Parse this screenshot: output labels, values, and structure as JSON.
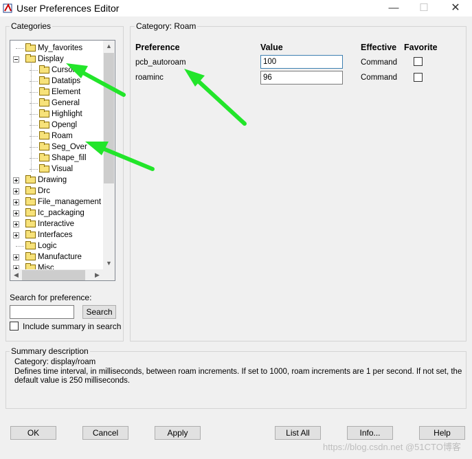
{
  "window": {
    "title": "User Preferences Editor",
    "minimize_glyph": "—",
    "maximize_glyph": "☐",
    "close_glyph": "✕"
  },
  "categories": {
    "label": "Categories",
    "nodes": [
      {
        "label": "My_favorites",
        "level": 0,
        "expander": "none"
      },
      {
        "label": "Display",
        "level": 0,
        "expander": "collapse"
      },
      {
        "label": "Cursor",
        "level": 1,
        "expander": "none"
      },
      {
        "label": "Datatips",
        "level": 1,
        "expander": "none"
      },
      {
        "label": "Element",
        "level": 1,
        "expander": "none"
      },
      {
        "label": "General",
        "level": 1,
        "expander": "none"
      },
      {
        "label": "Highlight",
        "level": 1,
        "expander": "none"
      },
      {
        "label": "Opengl",
        "level": 1,
        "expander": "none"
      },
      {
        "label": "Roam",
        "level": 1,
        "expander": "none"
      },
      {
        "label": "Seg_Over",
        "level": 1,
        "expander": "none"
      },
      {
        "label": "Shape_fill",
        "level": 1,
        "expander": "none"
      },
      {
        "label": "Visual",
        "level": 1,
        "expander": "none"
      },
      {
        "label": "Drawing",
        "level": 0,
        "expander": "expand"
      },
      {
        "label": "Drc",
        "level": 0,
        "expander": "expand"
      },
      {
        "label": "File_management",
        "level": 0,
        "expander": "expand"
      },
      {
        "label": "Ic_packaging",
        "level": 0,
        "expander": "expand"
      },
      {
        "label": "Interactive",
        "level": 0,
        "expander": "expand"
      },
      {
        "label": "Interfaces",
        "level": 0,
        "expander": "expand"
      },
      {
        "label": "Logic",
        "level": 0,
        "expander": "none"
      },
      {
        "label": "Manufacture",
        "level": 0,
        "expander": "expand"
      },
      {
        "label": "Misc",
        "level": 0,
        "expander": "expand"
      }
    ]
  },
  "search": {
    "label": "Search for preference:",
    "value": "",
    "button": "Search",
    "include_summary_label": "Include summary in search",
    "include_summary_checked": false
  },
  "category_panel": {
    "label": "Category:  Roam",
    "headers": {
      "preference": "Preference",
      "value": "Value",
      "effective": "Effective",
      "favorite": "Favorite"
    },
    "rows": [
      {
        "preference": "pcb_autoroam",
        "value": "100",
        "effective": "Command",
        "favorite": false
      },
      {
        "preference": "roaminc",
        "value": "96",
        "effective": "Command",
        "favorite": false
      }
    ]
  },
  "summary": {
    "label": "Summary description",
    "lines": [
      "Category: display/roam",
      "Defines time interval, in milliseconds, between roam increments. If set to 1000, roam increments are 1 per second. If not set, the",
      "default value is 250 milliseconds."
    ]
  },
  "buttons": {
    "ok": "OK",
    "cancel": "Cancel",
    "apply": "Apply",
    "list_all": "List All",
    "info": "Info...",
    "help": "Help"
  },
  "watermark": "https://blog.csdn.net  @51CTO博客",
  "colors": {
    "annotation_arrow": "#22e52a",
    "folder": "#f7e27a"
  }
}
